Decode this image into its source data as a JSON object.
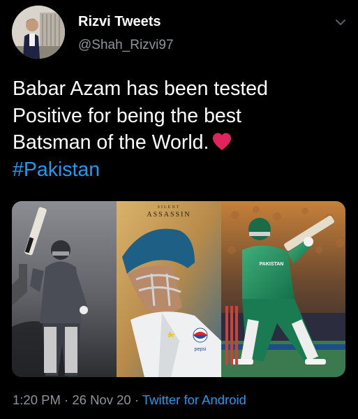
{
  "author": {
    "display_name": "Rizvi Tweets",
    "handle": "@Shah_Rizvi97",
    "avatar_icon": "profile-photo"
  },
  "tweet": {
    "lines": [
      "Babar Azam has been tested",
      "Positive for being the best",
      "Batsman of the World."
    ],
    "emoji_icon": "red-heart-icon",
    "hashtag": "#Pakistan"
  },
  "media": {
    "poster_title_small": "SILENT",
    "poster_title": "ASSASSIN",
    "sponsor_text": "pepsi",
    "jersey_text": "PAKISTAN"
  },
  "meta": {
    "time": "1:20 PM",
    "separator": "·",
    "date": "26 Nov 20",
    "source": "Twitter for Android"
  },
  "colors": {
    "background": "#000000",
    "text": "#ffffff",
    "secondary": "#8f9499",
    "link": "#1d9bf0",
    "heart": "#e0245e"
  }
}
